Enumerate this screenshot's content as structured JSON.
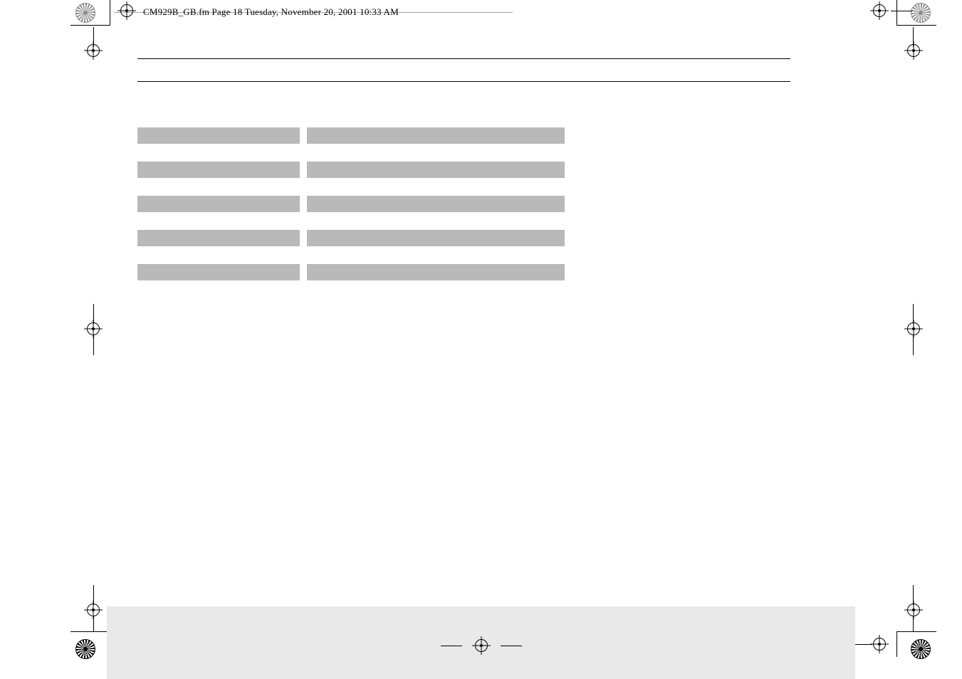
{
  "meta": {
    "header_text": "CM929B_GB.fm  Page 18  Tuesday, November 20, 2001  10:33 AM"
  },
  "colors": {
    "cell_grey": "#b9b9b9",
    "footer_grey": "#e9e9e9"
  },
  "table": {
    "rows": 5,
    "columns": 2
  }
}
